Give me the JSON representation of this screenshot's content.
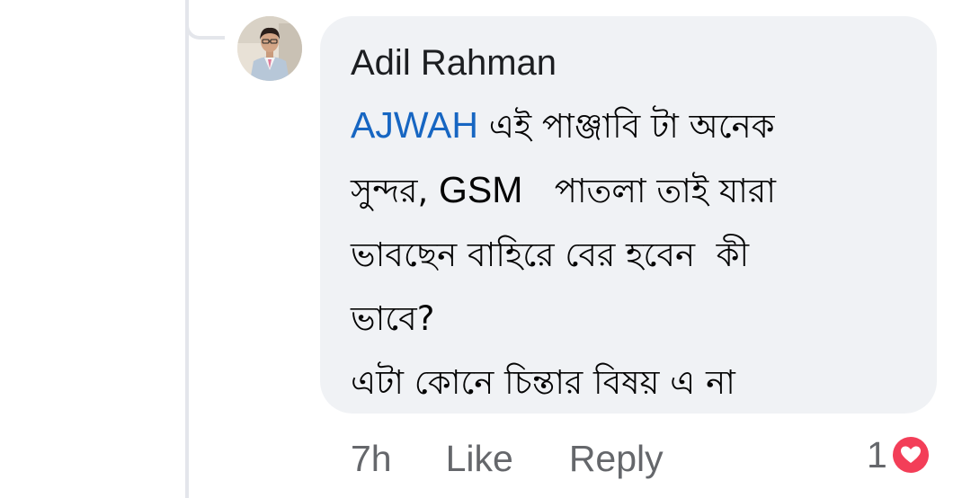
{
  "comment": {
    "author": "Adil Rahman",
    "mention": "AJWAH",
    "line1_rest": " এই পাঞ্জাবি টা অনেক",
    "line2_a": "সুন্দর, ",
    "line2_gsm": "GSM",
    "line2_b": "   পাতলা তাই যারা",
    "line3": "ভাবছেন বাহিরে বের হবেন  কী",
    "line4": "ভাবে?",
    "line5": "এটা কোনে চিন্তার বিষয় এ না"
  },
  "actions": {
    "time": "7h",
    "like_label": "Like",
    "reply_label": "Reply"
  },
  "reactions": {
    "count": "1",
    "type": "love",
    "icon": "heart-icon",
    "color": "#f33e58"
  },
  "colors": {
    "bubble": "#f0f2f5",
    "mention": "#1766c2",
    "meta": "#65676b",
    "thread_line": "#e4e6eb"
  }
}
